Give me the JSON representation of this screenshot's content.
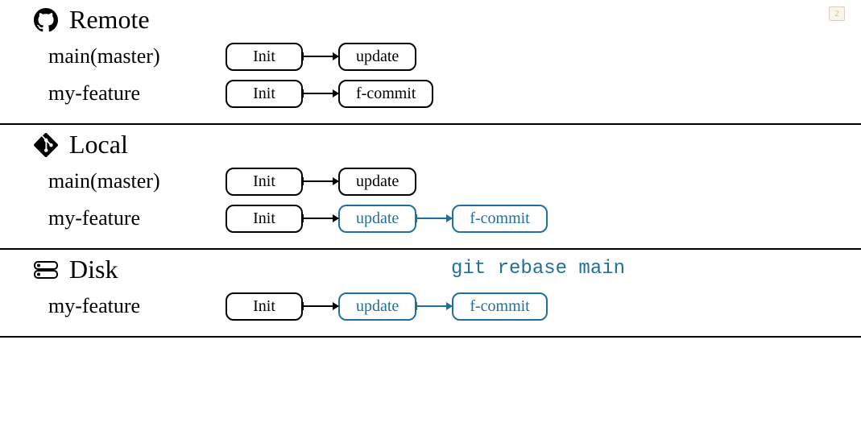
{
  "badge": "2",
  "remote": {
    "title": "Remote",
    "branches": [
      {
        "label": "main(master)",
        "commits": [
          {
            "text": "Init",
            "style": "black"
          },
          {
            "text": "update",
            "style": "black"
          }
        ]
      },
      {
        "label": "my-feature",
        "commits": [
          {
            "text": "Init",
            "style": "black"
          },
          {
            "text": "f-commit",
            "style": "black"
          }
        ]
      }
    ]
  },
  "local": {
    "title": "Local",
    "branches": [
      {
        "label": "main(master)",
        "commits": [
          {
            "text": "Init",
            "style": "black"
          },
          {
            "text": "update",
            "style": "black"
          }
        ]
      },
      {
        "label": "my-feature",
        "commits": [
          {
            "text": "Init",
            "style": "black"
          },
          {
            "text": "update",
            "style": "blue"
          },
          {
            "text": "f-commit",
            "style": "blue"
          }
        ]
      }
    ]
  },
  "disk": {
    "title": "Disk",
    "command": "git rebase main",
    "branches": [
      {
        "label": "my-feature",
        "commits": [
          {
            "text": "Init",
            "style": "black"
          },
          {
            "text": "update",
            "style": "blue"
          },
          {
            "text": "f-commit",
            "style": "blue"
          }
        ]
      }
    ]
  }
}
